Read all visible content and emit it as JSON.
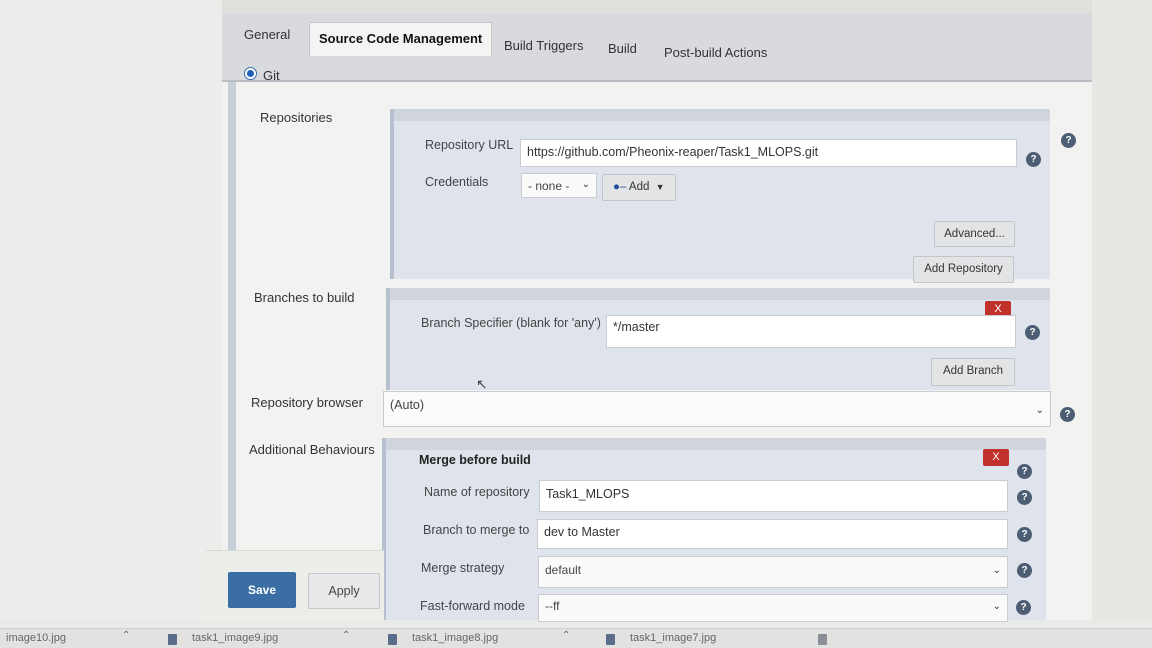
{
  "tabs": [
    {
      "label": "General"
    },
    {
      "label": "Source Code Management"
    },
    {
      "label": "Build Triggers"
    },
    {
      "label": "Build"
    },
    {
      "label": "Post-build Actions"
    }
  ],
  "scm": {
    "git_label": "Git",
    "repositories_label": "Repositories",
    "repository_url_label": "Repository URL",
    "repository_url_value": "https://github.com/Pheonix-reaper/Task1_MLOPS.git",
    "credentials_label": "Credentials",
    "credentials_value": "- none -",
    "add_label": "Add",
    "advanced_label": "Advanced...",
    "add_repository_label": "Add Repository",
    "branches_label": "Branches to build",
    "branch_specifier_label": "Branch Specifier (blank for 'any')",
    "branch_specifier_value": "*/master",
    "add_branch_label": "Add Branch",
    "repo_browser_label": "Repository browser",
    "repo_browser_value": "(Auto)",
    "additional_behaviours_label": "Additional Behaviours",
    "merge_title": "Merge before build",
    "name_of_repository_label": "Name of repository",
    "name_of_repository_value": "Task1_MLOPS",
    "branch_to_merge_label": "Branch to merge to",
    "branch_to_merge_value": "dev to Master",
    "merge_strategy_label": "Merge strategy",
    "merge_strategy_value": "default",
    "fast_forward_label": "Fast-forward mode",
    "fast_forward_value": "--ff",
    "delete_label": "X",
    "help_glyph": "?"
  },
  "footer": {
    "save_label": "Save",
    "apply_label": "Apply"
  },
  "downloads": [
    {
      "name": "image10.jpg"
    },
    {
      "name": "task1_image9.jpg"
    },
    {
      "name": "task1_image8.jpg"
    },
    {
      "name": "task1_image7.jpg"
    }
  ],
  "icons": {
    "key": "key-icon",
    "help": "help-icon",
    "caret": "chevron-down-icon",
    "radio": "radio-selected-icon",
    "pointer": "mouse-pointer-icon"
  }
}
